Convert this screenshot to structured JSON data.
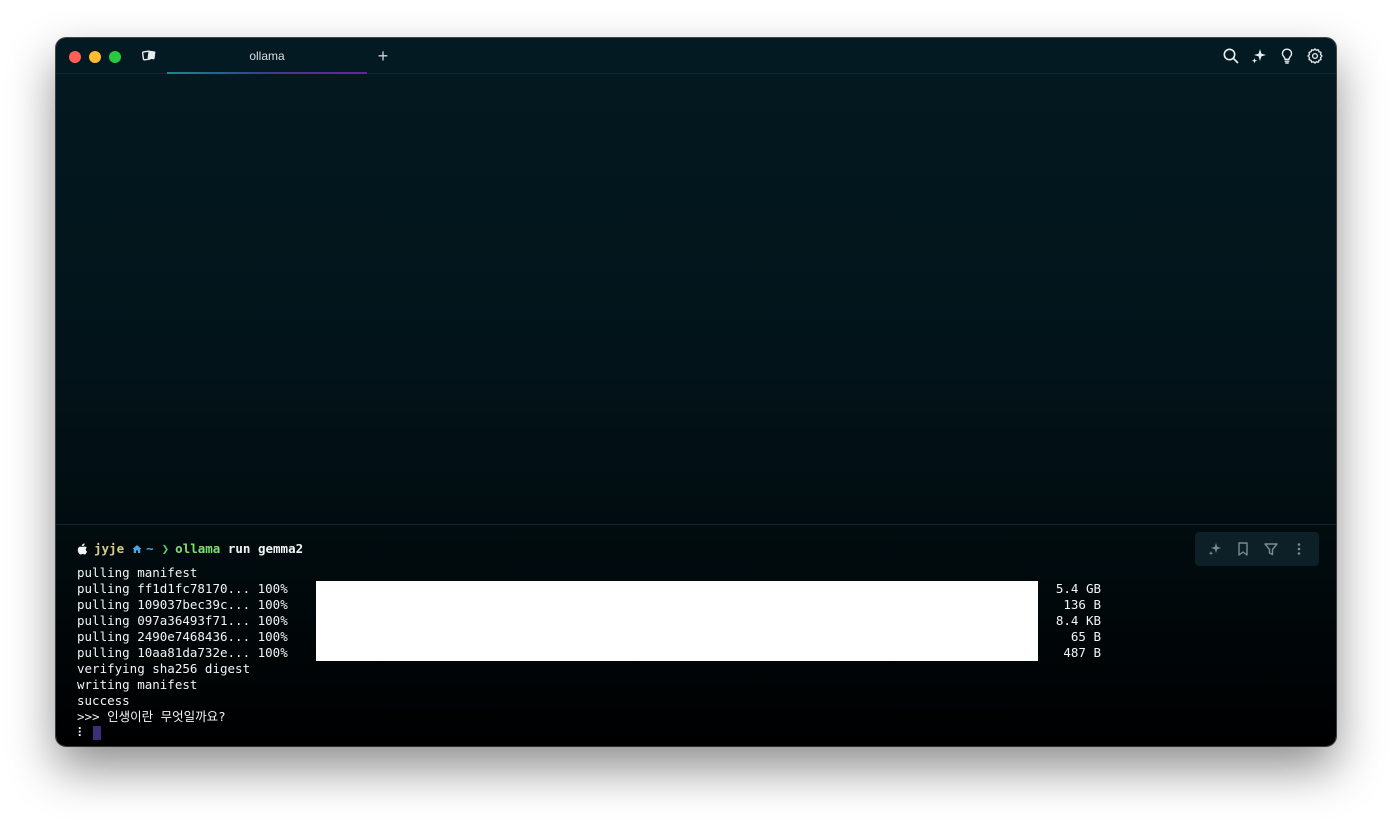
{
  "window": {
    "tab_title": "ollama",
    "new_tab_label": "+"
  },
  "toolbar_icons": [
    "search-icon",
    "ai-sparkle-icon",
    "lightbulb-icon",
    "settings-gear-icon"
  ],
  "block_actions": [
    "ai-sparkle-icon",
    "bookmark-icon",
    "filter-icon",
    "more-vertical-icon"
  ],
  "prompt": {
    "user": "jyje",
    "path": "~",
    "chevron": "❯",
    "command": "ollama",
    "args": "run gemma2"
  },
  "output": {
    "pulling_manifest": "pulling manifest",
    "pulls": [
      {
        "text": "pulling ff1d1fc78170... 100%",
        "progress": 1.0,
        "size": "5.4 GB"
      },
      {
        "text": "pulling 109037bec39c... 100%",
        "progress": 1.0,
        "size": "136 B"
      },
      {
        "text": "pulling 097a36493f71... 100%",
        "progress": 1.0,
        "size": "8.4 KB"
      },
      {
        "text": "pulling 2490e7468436... 100%",
        "progress": 1.0,
        "size": "65 B"
      },
      {
        "text": "pulling 10aa81da732e... 100%",
        "progress": 1.0,
        "size": "487 B"
      }
    ],
    "verifying": "verifying sha256 digest",
    "writing": "writing manifest",
    "success": "success",
    "repl_prompt": ">>> 인생이란 무엇일까요?",
    "spinner": "⠇"
  },
  "colors": {
    "user": "#d9cb8a",
    "path": "#4aa6e0",
    "command": "#7fe06a",
    "cursor": "#3d2e7a"
  }
}
